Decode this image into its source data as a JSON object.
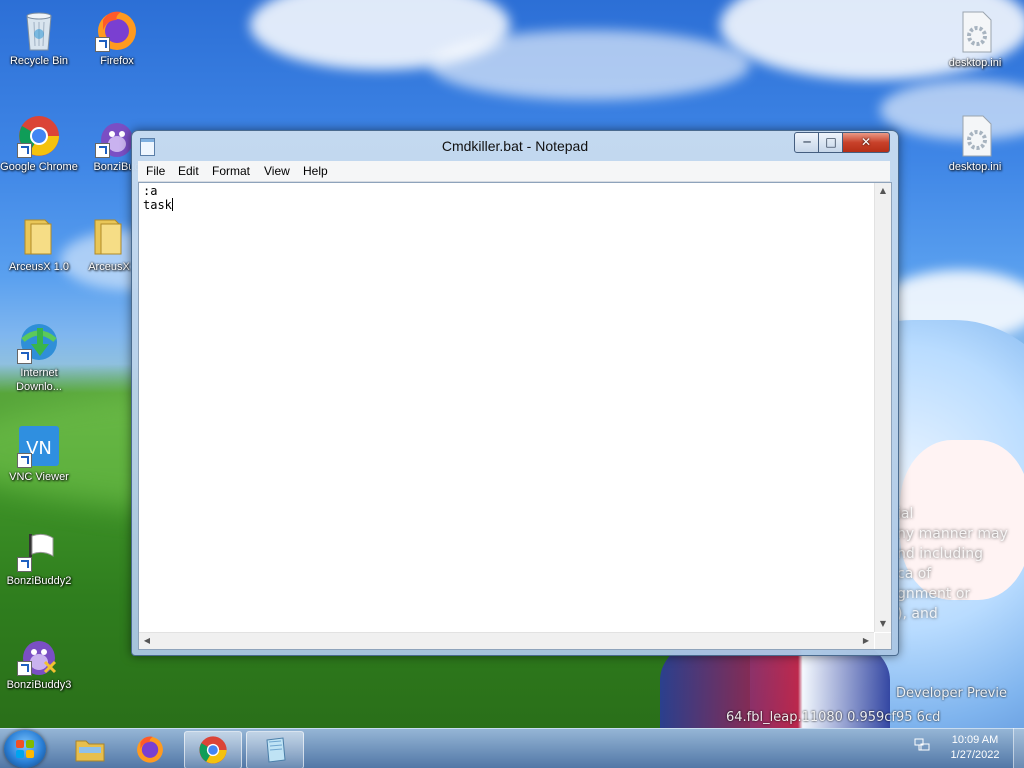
{
  "desktop": {
    "icons": [
      {
        "id": "recycle-bin",
        "label": "Recycle Bin"
      },
      {
        "id": "firefox",
        "label": "Firefox"
      },
      {
        "id": "google-chrome",
        "label": "Google Chrome"
      },
      {
        "id": "bonzibuddy",
        "label": "BonziBud"
      },
      {
        "id": "arceusx",
        "label": "ArceusX 1.0"
      },
      {
        "id": "arceusx-2",
        "label": "ArceusX"
      },
      {
        "id": "internet-download",
        "label": "Internet Downlo..."
      },
      {
        "id": "vnc-viewer",
        "label": "VNC Viewer"
      },
      {
        "id": "bonzibuddy2",
        "label": "BonziBuddy2"
      },
      {
        "id": "bonzibuddy3",
        "label": "BonziBuddy3"
      },
      {
        "id": "desktop-ini-1",
        "label": "desktop.ini"
      },
      {
        "id": "desktop-ini-2",
        "label": "desktop.ini"
      }
    ],
    "watermark": {
      "line1": "ial",
      "line2": "ny manner may",
      "line3": "nd including",
      "line4": "ca    of",
      "line5": "gnment or",
      "line6": "   ), and",
      "developer": "Developer Previe",
      "build": "64.fbl_leap.11080       0.959cf95       6cd"
    }
  },
  "notepad": {
    "title": "Cmdkiller.bat - Notepad",
    "menu": [
      "File",
      "Edit",
      "Format",
      "View",
      "Help"
    ],
    "content_line1": ":a",
    "content_line2": "task",
    "controls": {
      "minimize": "─",
      "maximize": "□",
      "close": "✕"
    }
  },
  "taskbar": {
    "pinned": [
      "start-button",
      "file-explorer",
      "firefox",
      "google-chrome",
      "notepad"
    ],
    "clock": {
      "time": "10:09 AM",
      "date": "1/27/2022"
    }
  }
}
